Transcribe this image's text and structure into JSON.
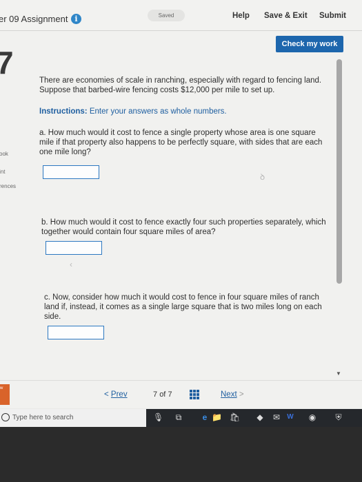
{
  "header": {
    "assignment_title": "er 09 Assignment",
    "info_icon_glyph": "i",
    "saved_label": "Saved",
    "help": "Help",
    "save_exit": "Save & Exit",
    "submit": "Submit"
  },
  "check_button": "Check my work",
  "question_number": "7",
  "side_links": [
    "ook",
    "int",
    "rences"
  ],
  "question": {
    "intro": "There are economies of scale in ranching, especially with regard to fencing land. Suppose that barbed-wire fencing costs $12,000 per mile to set up.",
    "instructions_label": "Instructions:",
    "instructions_text": "Enter your answers as whole numbers.",
    "part_a": "a. How much would it cost to fence a single property whose area is one square mile if that property also happens to be perfectly square, with sides that are each one mile long?",
    "part_b": "b. How much would it cost to fence exactly four such properties separately, which together would contain four square miles of area?",
    "part_c": "c. Now, consider how much it would cost to fence in four square miles of ranch land if, instead, it comes as a single large square that is two miles long on each side."
  },
  "answers": {
    "a": "",
    "b": "",
    "c": ""
  },
  "footer": {
    "left_tab": "w",
    "prev_glyph": "<",
    "prev": "Prev",
    "current_page": "7",
    "of_label": "of",
    "total_pages": "7",
    "next": "Next",
    "next_glyph": ">"
  },
  "taskbar": {
    "search_placeholder": "Type here to search"
  },
  "colors": {
    "accent": "#1d66ad",
    "link": "#1f5fa0",
    "info": "#2f86c8"
  }
}
